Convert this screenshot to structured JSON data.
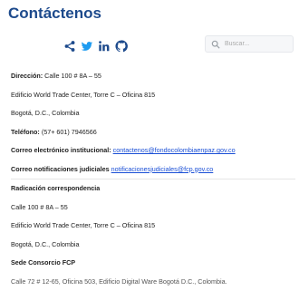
{
  "page": {
    "title": "Contáctenos"
  },
  "social": {
    "share_icon": "share-icon",
    "twitter_icon": "twitter-icon",
    "linkedin_icon": "linkedin-icon",
    "github_icon": "github-icon"
  },
  "search": {
    "placeholder": "Buscar..."
  },
  "contact": {
    "direccion_label": "Dirección:",
    "direccion_value": "Calle 100 # 8A – 55",
    "edificio": "Edificio World Trade Center, Torre C – Oficina 815",
    "ciudad": "Bogotá, D.C., Colombia",
    "telefono_label": "Teléfono:",
    "telefono_value": "(57+ 601) 7946566",
    "correo_label": "Correo electrónico institucional:",
    "correo_value": "contactenos@fondocolombiaenpaz.gov.co",
    "notif_label": "Correo notificaciones judiciales",
    "notif_value": "notificacionesjudiciales@fcp.gov.co"
  },
  "radicacion": {
    "heading": "Radicación correspondencia",
    "direccion": "Calle 100 # 8A – 55",
    "edificio": "Edificio World Trade Center, Torre C – Oficina 815",
    "ciudad": "Bogotá, D.C., Colombia"
  },
  "sede": {
    "heading": "Sede Consorcio FCP",
    "direccion": "Calle 72 # 12-65, Oficina 503, Edificio Digital Ware Bogotá D.C., Colombia."
  },
  "colors": {
    "title": "#1d4a8c",
    "link": "#1a4fd6",
    "social": "#1d9bf0"
  }
}
